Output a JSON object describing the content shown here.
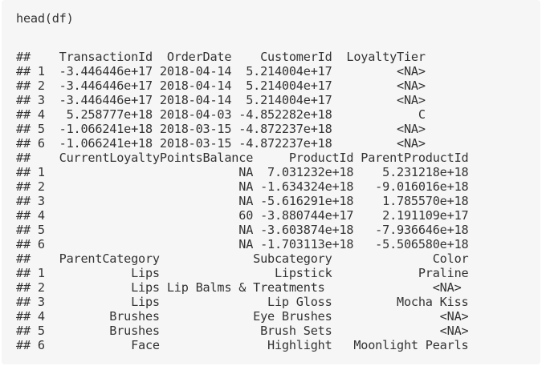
{
  "code": "head(df)",
  "output_lines": [
    "##    TransactionId  OrderDate    CustomerId  LoyaltyTier",
    "## 1  -3.446446e+17 2018-04-14  5.214004e+17         <NA>",
    "## 2  -3.446446e+17 2018-04-14  5.214004e+17         <NA>",
    "## 3  -3.446446e+17 2018-04-14  5.214004e+17         <NA>",
    "## 4   5.258777e+18 2018-04-03 -4.852282e+18            C",
    "## 5  -1.066241e+18 2018-03-15 -4.872237e+18         <NA>",
    "## 6  -1.066241e+18 2018-03-15 -4.872237e+18         <NA>",
    "##    CurrentLoyaltyPointsBalance     ProductId ParentProductId",
    "## 1                           NA  7.031232e+18    5.231218e+18",
    "## 2                           NA -1.634324e+18   -9.016016e+18",
    "## 3                           NA -5.616291e+18    1.785570e+18",
    "## 4                           60 -3.880744e+17    2.191109e+17",
    "## 5                           NA -3.603874e+18   -7.936646e+18",
    "## 6                           NA -1.703113e+18   -5.506580e+18",
    "##    ParentCategory             Subcategory              Color",
    "## 1            Lips                Lipstick            Praline",
    "## 2            Lips Lip Balms & Treatments               <NA>",
    "## 3            Lips               Lip Gloss         Mocha Kiss",
    "## 4         Brushes             Eye Brushes               <NA>",
    "## 5         Brushes              Brush Sets               <NA>",
    "## 6            Face               Highlight   Moonlight Pearls"
  ],
  "colors": {
    "panel_background": "#f6f6f6",
    "text": "#333333"
  }
}
